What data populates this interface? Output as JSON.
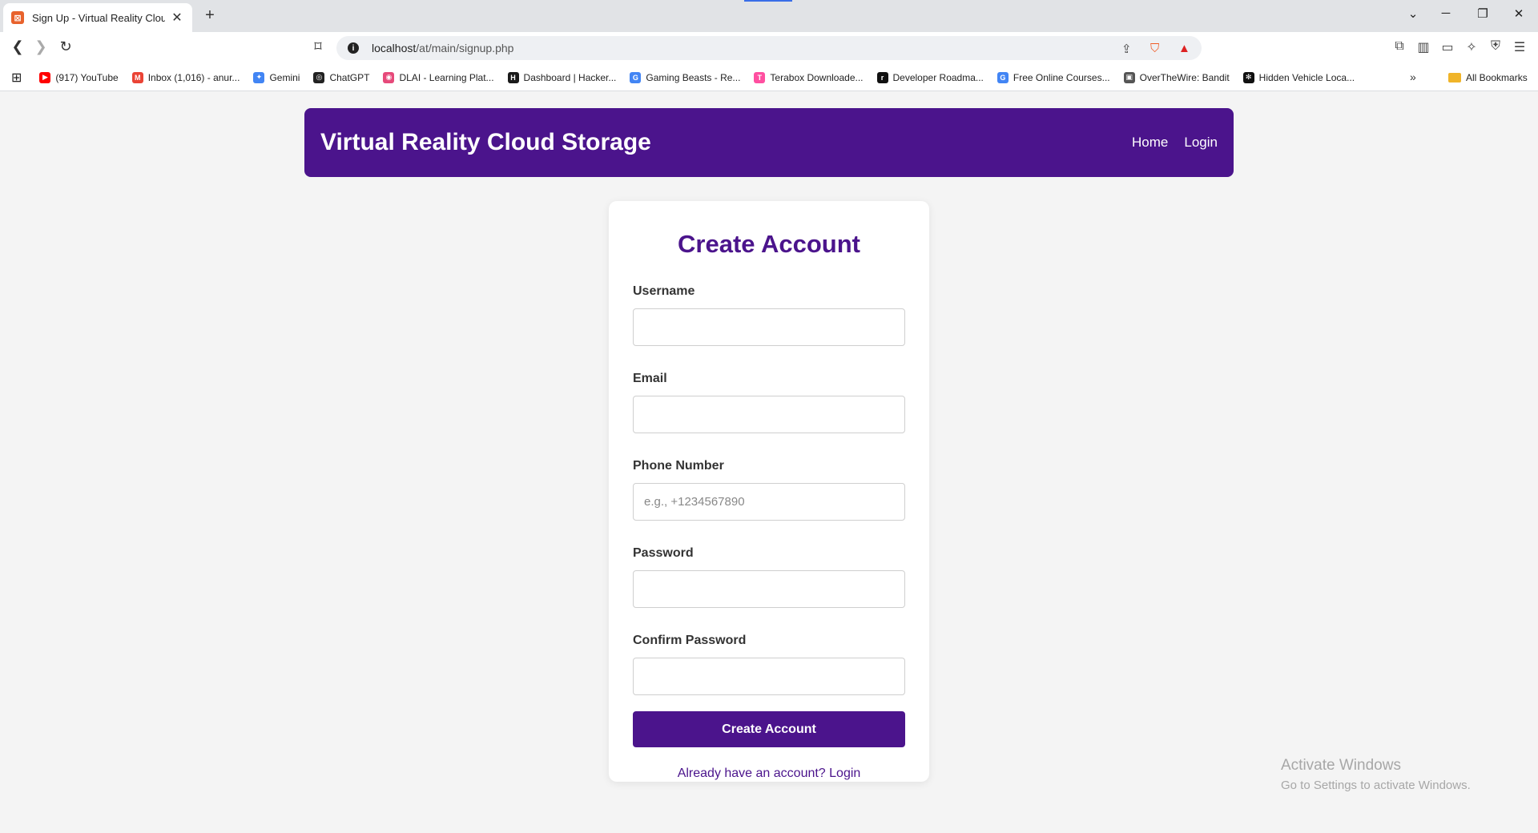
{
  "browser": {
    "tab_title": "Sign Up - Virtual Reality Cloud Storage",
    "tab_close": "✕",
    "new_tab": "+",
    "url_host": "localhost",
    "url_path": "/at/main/signup.php",
    "bookmarks": [
      {
        "label": "(917) YouTube",
        "color": "#ff0000",
        "glyph": "▶"
      },
      {
        "label": "Inbox (1,016) - anur...",
        "color": "#ea4335",
        "glyph": "M"
      },
      {
        "label": "Gemini",
        "color": "#4285f4",
        "glyph": "✦"
      },
      {
        "label": "ChatGPT",
        "color": "#222222",
        "glyph": "◎"
      },
      {
        "label": "DLAI - Learning Plat...",
        "color": "#e6497a",
        "glyph": "◉"
      },
      {
        "label": "Dashboard | Hacker...",
        "color": "#1a1a1a",
        "glyph": "H"
      },
      {
        "label": "Gaming Beasts - Re...",
        "color": "#4285f4",
        "glyph": "G"
      },
      {
        "label": "Terabox Downloade...",
        "color": "#ff4fa0",
        "glyph": "T"
      },
      {
        "label": "Developer Roadma...",
        "color": "#111111",
        "glyph": "r"
      },
      {
        "label": "Free Online Courses...",
        "color": "#4285f4",
        "glyph": "G"
      },
      {
        "label": "OverTheWire: Bandit",
        "color": "#555555",
        "glyph": "▣"
      },
      {
        "label": "Hidden Vehicle Loca...",
        "color": "#111111",
        "glyph": "✻"
      }
    ],
    "all_bookmarks": "All Bookmarks"
  },
  "site": {
    "title": "Virtual Reality Cloud Storage",
    "nav": {
      "home": "Home",
      "login": "Login"
    }
  },
  "form": {
    "heading": "Create Account",
    "username_label": "Username",
    "username_value": "",
    "email_label": "Email",
    "email_value": "",
    "phone_label": "Phone Number",
    "phone_placeholder": "e.g., +1234567890",
    "password_label": "Password",
    "confirm_label": "Confirm Password",
    "submit_label": "Create Account",
    "login_link": "Already have an account? Login"
  },
  "watermark": {
    "line1": "Activate Windows",
    "line2": "Go to Settings to activate Windows."
  },
  "colors": {
    "brand": "#4b148c",
    "page_bg": "#f4f4f4"
  }
}
